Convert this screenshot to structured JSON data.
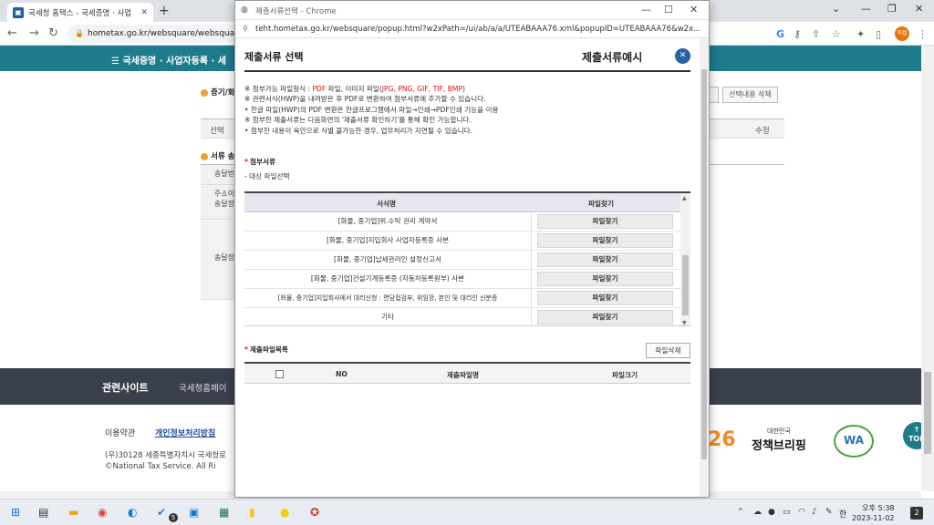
{
  "browser": {
    "tab_title": "국세청 홈택스 - 국세증명 · 사업",
    "url": "hometax.go.kr/websquare/websquare.w",
    "profile_label": "미접"
  },
  "page": {
    "header_menu": "☰  국세증명 · 사업자등록 · 세",
    "section1_title": "증기/화",
    "btn_right1": "",
    "btn_delete_selected": "선택내용 삭제",
    "table_col_select": "선택",
    "table_col_edit": "수정",
    "section2_title": "서류 송",
    "row_labels": [
      "송달받",
      "주소이\n송달장",
      "송달장"
    ],
    "footer_related": "관련사이트",
    "footer_nts": "국세청홈페이",
    "footer_terms": "이용약관",
    "footer_privacy": "개인정보처리방침",
    "footer_addr": "(우)30128 세종특별자치시 국세청로",
    "footer_copy": "©National Tax Service. All Ri",
    "logo_26": "26",
    "logo_policy_small": "대한민국",
    "logo_policy": "정책브리핑",
    "logo_wa": "WA",
    "top_button": "TOP"
  },
  "popup": {
    "window_title": "제출서류선택 - Chrome",
    "url": "teht.hometax.go.kr/websquare/popup.html?w2xPath=/ui/ab/a/a/UTEABAAA76.xml&popupID=UTEABAAA76&w2x...",
    "title_left": "제출서류 선택",
    "title_right": "제출서류예시",
    "notes": [
      {
        "pre": "※ 첨부가능 파일형식 : ",
        "red1": "PDF",
        "mid": " 파일, 이미지 파일(",
        "red2": "JPG, PNG, GIF, TIF, BMP",
        "post": ")"
      },
      {
        "text": "※ 관련서식(HWP)을 내려받은 후 PDF로 변환하여 첨부서류에 추가할 수 있습니다."
      },
      {
        "text": "  • 한글 파일(HWP)의 PDF 변환은 한글프로그램에서 파일→인쇄→PDF인쇄 기능을 이용"
      },
      {
        "text": "※ 첨부한 제출서류는 다음화면의 '제출서류 확인하기'를 통해 확인 가능합니다."
      },
      {
        "text": "  • 첨부한 내용이 육안으로 식별 불가능한 경우, 업무처리가 지연될 수 있습니다."
      }
    ],
    "attach_header": "첨부서류",
    "attach_sub": "- 대상 파일선택",
    "table": {
      "col_form": "서식명",
      "col_find": "파일찾기",
      "rows": [
        {
          "name": "[화물, 중기업]위.수탁 관리 계약서",
          "button": "파일찾기"
        },
        {
          "name": "[화물, 중기업]지입회사 사업자등록증 사본",
          "button": "파일찾기"
        },
        {
          "name": "[화물, 중기업]납세관리인 설정신고서",
          "button": "파일찾기"
        },
        {
          "name": "[화물, 중기업]건설기계등록증 (자동차등록원부) 사본",
          "button": "파일찾기"
        },
        {
          "name": "[화물, 중기업]지입회사에서 대리신청 : 면담접검부, 위임장, 본인 및 대리인 신분증",
          "button": "파일찾기"
        },
        {
          "name": "기타",
          "button": "파일찾기"
        }
      ]
    },
    "submit_header": "제출파일목록",
    "delete_button": "파일삭제",
    "submit_table": {
      "col_no": "NO",
      "col_name": "제출파일명",
      "col_size": "파일크기"
    }
  },
  "taskbar": {
    "clock_time": "오후 5:38",
    "clock_date": "2023-11-02",
    "ime": "한",
    "notifications": "2",
    "badge5": "5"
  }
}
